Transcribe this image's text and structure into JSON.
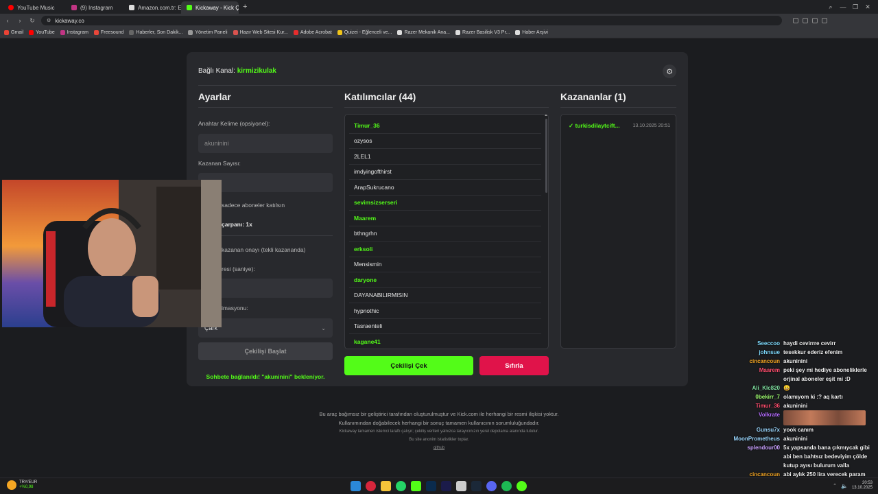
{
  "browser": {
    "tabs": [
      {
        "label": "YouTube Music",
        "color": "#ff0000",
        "active": false
      },
      {
        "label": "(9) Instagram",
        "color": "#c13584",
        "active": false
      },
      {
        "label": "Amazon.com.tr: Elektronik",
        "color": "#dddddd",
        "active": false
      },
      {
        "label": "Kickaway - Kick Çekiliş Ara",
        "color": "#53fc18",
        "active": true
      }
    ],
    "url": "kickaway.co",
    "bookmarks": [
      {
        "label": "Gmail",
        "color": "#ea4335"
      },
      {
        "label": "YouTube",
        "color": "#ff0000"
      },
      {
        "label": "Instagram",
        "color": "#c13584"
      },
      {
        "label": "Freesound",
        "color": "#e8473a"
      },
      {
        "label": "Haberler, Son Dakik...",
        "color": "#666666"
      },
      {
        "label": "Yönetim Paneli",
        "color": "#999999"
      },
      {
        "label": "Hazır Web Sitesi Kur...",
        "color": "#d9534f"
      },
      {
        "label": "Adobe Acrobat",
        "color": "#e62d2d"
      },
      {
        "label": "Quizei - Eğlenceli ve...",
        "color": "#f0c419"
      },
      {
        "label": "Razer Mekanik Ana...",
        "color": "#dddddd"
      },
      {
        "label": "Razer Basilisk V3 Pr...",
        "color": "#dddddd"
      },
      {
        "label": "Haber Arşivi",
        "color": "#dddddd"
      }
    ]
  },
  "header": {
    "channel_label": "Bağlı Kanal:",
    "channel_name": "kirmizikulak"
  },
  "settings": {
    "title": "Ayarlar",
    "keyword_label": "Anahtar Kelime (opsiyonel):",
    "keyword_value": "akuninini",
    "winner_count_label": "Kazanan Sayısı:",
    "subs_only": "sadece aboneler katılsın",
    "multiplier": "çarpanı: 1x",
    "approval": "kazanan onayı (tekli kazananda)",
    "duration_label": "resi (saniye):",
    "animation_label": "imasyonu:",
    "animation_value": "Çark",
    "start_button": "Çekilişi Başlat",
    "status": "Sohbete bağlanıldı! \"akuninini\" bekleniyor."
  },
  "participants": {
    "title": "Katılımcılar (44)",
    "list": [
      {
        "name": "Timur_36",
        "sub": true
      },
      {
        "name": "ozysos",
        "sub": false
      },
      {
        "name": "2LEL1",
        "sub": false
      },
      {
        "name": "imdyingofthirst",
        "sub": false
      },
      {
        "name": "ArapSukrucano",
        "sub": false
      },
      {
        "name": "sevimsizserseri",
        "sub": true
      },
      {
        "name": "Maarem",
        "sub": true
      },
      {
        "name": "bthngrhn",
        "sub": false
      },
      {
        "name": "erksoli",
        "sub": true
      },
      {
        "name": "Mensismin",
        "sub": false
      },
      {
        "name": "daryone",
        "sub": true
      },
      {
        "name": "DAYANABILIRMISIN",
        "sub": false
      },
      {
        "name": "hypnothic",
        "sub": false
      },
      {
        "name": "Tasraenteli",
        "sub": false
      },
      {
        "name": "kagane41",
        "sub": true
      }
    ],
    "draw_button": "Çekilişi Çek",
    "reset_button": "Sıfırla"
  },
  "winners": {
    "title": "Kazananlar (1)",
    "list": [
      {
        "name": "✓ turkisdilaytcift...",
        "date": "13.10.2025 20:51"
      }
    ]
  },
  "footer": {
    "line1": "Bu araç bağımsız bir geliştirici tarafından oluşturulmuştur ve Kick.com ile herhangi bir resmi ilişkisi yoktur.",
    "line2": "Kullanımından doğabilecek herhangi bir sonuç tamamen kullanıcının sorumluluğundadır.",
    "line3": "Kickaway tamamen istemci taraflı çalışır; çekiliş verileri yalnızca tarayıcınızın yerel depolama alanında tutulur.",
    "line4": "Bu site anonim istatistikler toplar.",
    "link": "github"
  },
  "chat": [
    {
      "user": "Seeccoo",
      "color": "#7fdcff",
      "text": "haydi cevirrre cevirr"
    },
    {
      "user": "johnsue",
      "color": "#7fdcff",
      "text": "tesekkur ederiz efenim"
    },
    {
      "user": "cincancoun",
      "color": "#f5a623",
      "text": "akuninini"
    },
    {
      "user": "Maarem",
      "color": "#ff4d6d",
      "text": "peki şey mi hediye aboneliklerle orjinal aboneler eşit mi :D"
    },
    {
      "user": "Ali_Klc820",
      "color": "#7fe0a0",
      "text": "😀"
    },
    {
      "user": "0bekirr_7",
      "color": "#a0ff70",
      "text": "olamıyom ki :? aq kartı"
    },
    {
      "user": "Timur_36",
      "color": "#ff4d6d",
      "text": "akuninini"
    },
    {
      "user": "Volkrate",
      "color": "#b56cff",
      "text": ""
    },
    {
      "user": "Gunsu7x",
      "color": "#9ad7ff",
      "text": "yook canım"
    },
    {
      "user": "MoonPrometheus",
      "color": "#9ad7ff",
      "text": "akuninini"
    },
    {
      "user": "splendour00",
      "color": "#c9a0ff",
      "text": "5x yapsanda bana çıkmıycak gibi abi ben bahtsız bedeviyim çölde kutup ayısı bulurum valla"
    },
    {
      "user": "cincancoun",
      "color": "#f5a623",
      "text": "abi aylık 250 lira verecek param yok ki"
    }
  ],
  "taskbar": {
    "ticker": "TRY/EUR",
    "change": "+%0,98",
    "time": "20:53",
    "date": "13.10.2025"
  }
}
